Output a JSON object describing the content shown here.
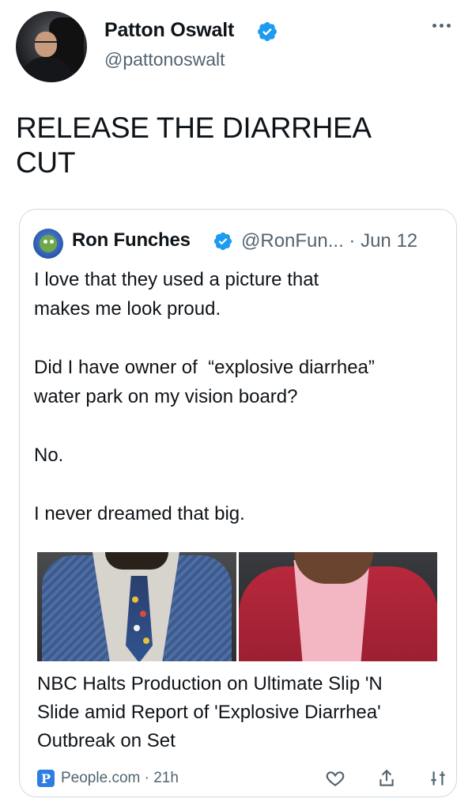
{
  "author": {
    "display_name": "Patton Oswalt",
    "handle": "@pattonoswalt",
    "verified": true
  },
  "tweet": {
    "text": "RELEASE THE DIARRHEA\nCUT"
  },
  "quoted_tweet": {
    "display_name": "Ron Funches",
    "meta": "@RonFun... · Jun 12",
    "verified": true,
    "text": "I love that they used a picture that\nmakes me look proud.\n\nDid I have owner of  “explosive diarrhea”\nwater park on my vision board?\n\nNo.\n\nI never dreamed that big.",
    "link_card": {
      "title": "NBC Halts Production on Ultimate Slip 'N\nSlide amid Report of 'Explosive Diarrhea'\nOutbreak on Set",
      "source_icon_letter": "P",
      "source": "People.com · 21h"
    }
  },
  "colors": {
    "verified_blue": "#1d9bf0",
    "muted_text": "#536471",
    "border": "#cfd9de",
    "people_blue": "#2f7de1"
  },
  "icons": [
    "more-options-icon",
    "verified-badge-icon",
    "like-icon",
    "share-icon",
    "audio-controls-icon"
  ]
}
